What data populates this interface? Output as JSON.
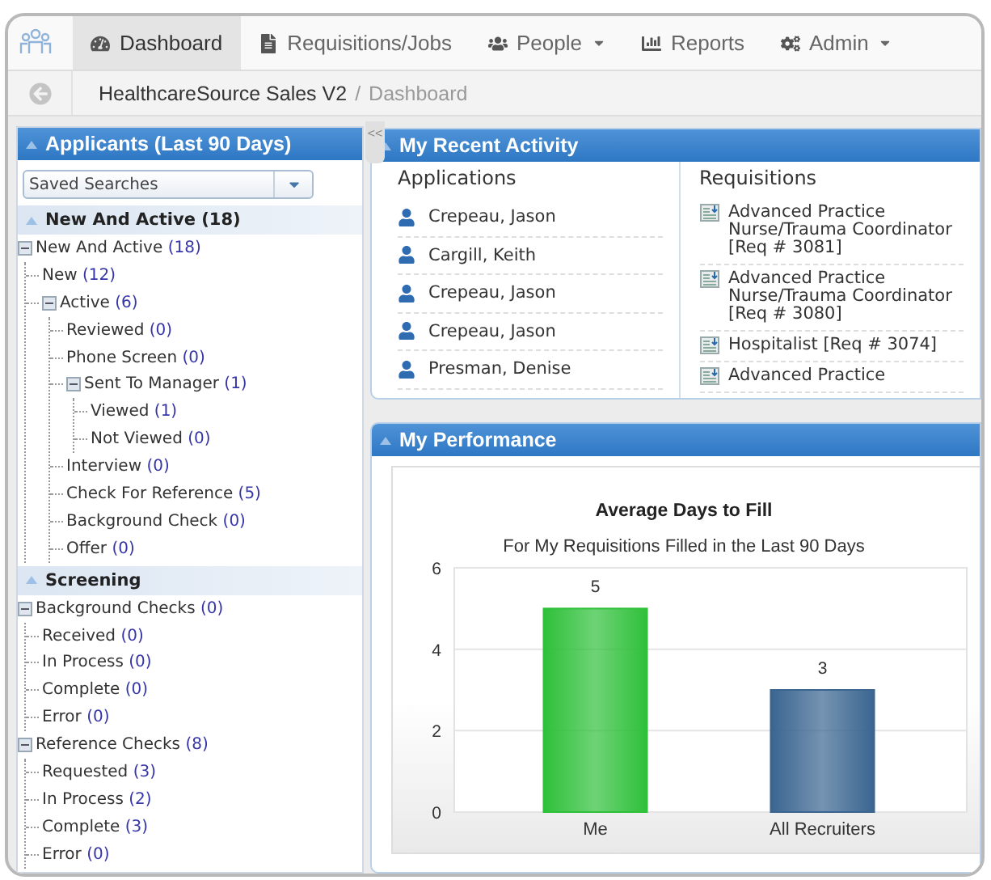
{
  "nav": {
    "tabs": [
      {
        "label": "Dashboard",
        "selected": true,
        "dropdown": false
      },
      {
        "label": "Requisitions/Jobs",
        "selected": false,
        "dropdown": false
      },
      {
        "label": "People",
        "selected": false,
        "dropdown": true
      },
      {
        "label": "Reports",
        "selected": false,
        "dropdown": false
      },
      {
        "label": "Admin",
        "selected": false,
        "dropdown": true
      }
    ]
  },
  "breadcrumb": {
    "items": [
      "HealthcareSource Sales V2",
      "Dashboard"
    ],
    "separator": "/"
  },
  "applicants_panel": {
    "title": "Applicants (Last 90 Days)",
    "handle": "<<",
    "saved_searches": {
      "value": "Saved Searches"
    },
    "sections": [
      {
        "title": "New And Active (18)",
        "expanded": true,
        "nodes": [
          {
            "label": "New And Active",
            "count": "(18)",
            "expanded": true,
            "children": [
              {
                "label": "New",
                "count": "(12)"
              },
              {
                "label": "Active",
                "count": "(6)",
                "expanded": true,
                "children": [
                  {
                    "label": "Reviewed",
                    "count": "(0)"
                  },
                  {
                    "label": "Phone Screen",
                    "count": "(0)"
                  },
                  {
                    "label": "Sent To Manager",
                    "count": "(1)",
                    "expanded": true,
                    "children": [
                      {
                        "label": "Viewed",
                        "count": "(1)"
                      },
                      {
                        "label": "Not Viewed",
                        "count": "(0)"
                      }
                    ]
                  },
                  {
                    "label": "Interview",
                    "count": "(0)"
                  },
                  {
                    "label": "Check For Reference",
                    "count": "(5)"
                  },
                  {
                    "label": "Background Check",
                    "count": "(0)"
                  },
                  {
                    "label": "Offer",
                    "count": "(0)"
                  }
                ]
              }
            ]
          }
        ]
      },
      {
        "title": "Screening",
        "expanded": true,
        "nodes": [
          {
            "label": "Background Checks",
            "count": "(0)",
            "expanded": true,
            "children": [
              {
                "label": "Received",
                "count": "(0)"
              },
              {
                "label": "In Process",
                "count": "(0)"
              },
              {
                "label": "Complete",
                "count": "(0)"
              },
              {
                "label": "Error",
                "count": "(0)"
              }
            ]
          },
          {
            "label": "Reference Checks",
            "count": "(8)",
            "expanded": true,
            "children": [
              {
                "label": "Requested",
                "count": "(3)"
              },
              {
                "label": "In Process",
                "count": "(2)"
              },
              {
                "label": "Complete",
                "count": "(3)"
              },
              {
                "label": "Error",
                "count": "(0)"
              }
            ]
          }
        ]
      }
    ]
  },
  "recent_activity": {
    "title": "My Recent Activity",
    "expanded": true,
    "applications": {
      "heading": "Applications",
      "items": [
        "Crepeau, Jason",
        "Cargill, Keith",
        "Crepeau, Jason",
        "Crepeau, Jason",
        "Presman, Denise"
      ]
    },
    "requisitions": {
      "heading": "Requisitions",
      "items": [
        {
          "title": "Advanced Practice Nurse/Trauma Coordinator",
          "req": "[Req # 3081]"
        },
        {
          "title": "Advanced Practice Nurse/Trauma Coordinator",
          "req": "[Req # 3080]"
        },
        {
          "title": "Hospitalist",
          "req": "[Req # 3074]"
        },
        {
          "title": "Advanced Practice"
        }
      ]
    }
  },
  "performance": {
    "title": "My Performance",
    "expanded": true,
    "chart_data": {
      "type": "bar",
      "title": "Average Days to Fill",
      "subtitle": "For My Requisitions Filled in the Last 90 Days",
      "categories": [
        "Me",
        "All Recruiters"
      ],
      "series": [
        {
          "values": [
            5,
            3
          ]
        }
      ],
      "colors": [
        "#2fc03a",
        "#3a6590"
      ],
      "ylim": [
        0,
        6
      ],
      "yticks": [
        0,
        2,
        4,
        6
      ],
      "data_labels": true
    }
  }
}
